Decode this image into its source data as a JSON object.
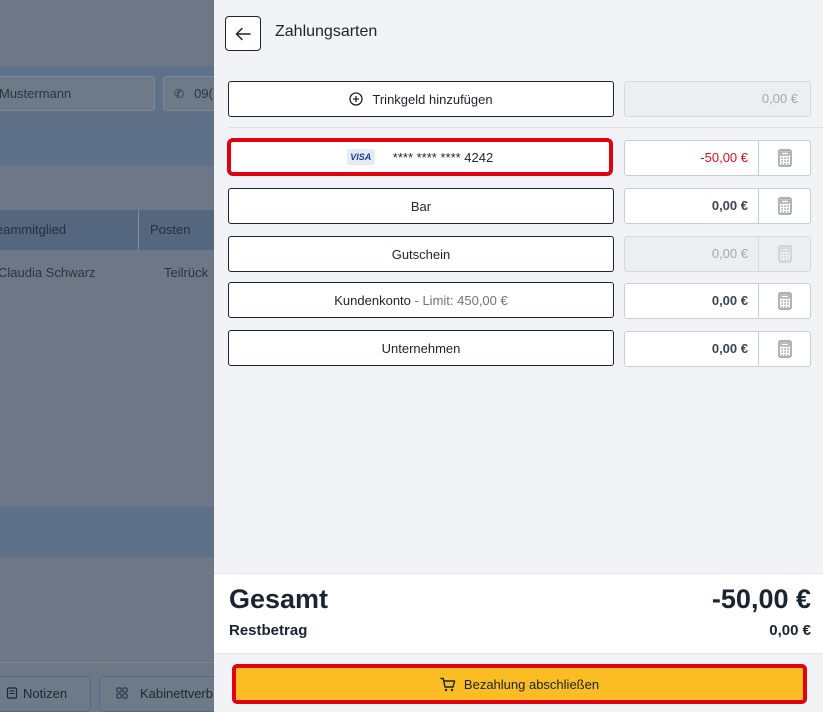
{
  "background": {
    "field_name": "Mustermann",
    "field_phone": "09(",
    "table_headers": [
      "eammitglied",
      "Posten"
    ],
    "row": [
      "Claudia Schwarz",
      "Teilrück"
    ],
    "footer_buttons": [
      "Notizen",
      "Kabinettverb"
    ]
  },
  "header": {
    "title": "Zahlungsarten",
    "back_icon": "arrow-left-icon"
  },
  "tip": {
    "label": "Trinkgeld hinzufügen",
    "amount": "0,00 €"
  },
  "payments": [
    {
      "name": "card",
      "brand": "VISA",
      "label": "**** **** **** 4242",
      "amount": "-50,00 €"
    },
    {
      "name": "bar",
      "label": "Bar",
      "amount": "0,00 €"
    },
    {
      "name": "gutschein",
      "label": "Gutschein",
      "amount": "0,00 €"
    },
    {
      "name": "kundenkonto",
      "label": "Kundenkonto",
      "limit": "- Limit: 450,00 €",
      "amount": "0,00 €"
    },
    {
      "name": "unternehmen",
      "label": "Unternehmen",
      "amount": "0,00 €"
    }
  ],
  "totals": {
    "gesamt_label": "Gesamt",
    "gesamt_value": "-50,00 €",
    "rest_label": "Restbetrag",
    "rest_value": "0,00 €"
  },
  "footer": {
    "pay_label": "Bezahlung abschließen"
  },
  "colors": {
    "accent": "#fbbd23",
    "highlight": "#e0000f",
    "negative": "#d0111b"
  }
}
